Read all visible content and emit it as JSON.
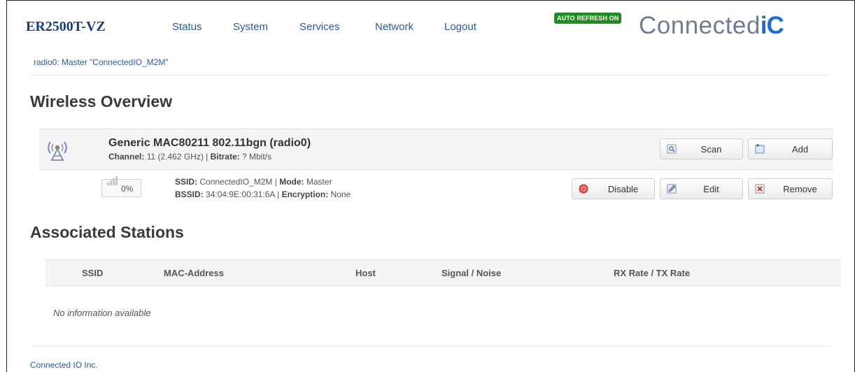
{
  "header": {
    "brand": "ER2500T-VZ",
    "nav": [
      {
        "label": "Status"
      },
      {
        "label": "System"
      },
      {
        "label": "Services"
      },
      {
        "label": "Network"
      },
      {
        "label": "Logout"
      }
    ],
    "auto_refresh": "AUTO REFRESH ON",
    "logo_text": "Connected",
    "logo_accent": "iC"
  },
  "breadcrumb": "radio0: Master \"ConnectedIO_M2M\"",
  "wireless": {
    "title": "Wireless Overview",
    "device": {
      "name": "Generic MAC80211 802.11bgn (radio0)",
      "channel_label": "Channel:",
      "channel_value": "11 (2.462 GHz)",
      "bitrate_label": "Bitrate:",
      "bitrate_value": "? Mbit/s",
      "icon": "wireless-radio-icon",
      "buttons": {
        "scan": "Scan",
        "add": "Add"
      }
    },
    "network": {
      "signal": "0%",
      "signal_fraction": 0.0,
      "ssid_label": "SSID:",
      "ssid_value": "ConnectedIO_M2M",
      "mode_label": "Mode:",
      "mode_value": "Master",
      "bssid_label": "BSSID:",
      "bssid_value": "34:04:9E:00:31:6A",
      "encryption_label": "Encryption:",
      "encryption_value": "None",
      "buttons": {
        "disable": "Disable",
        "edit": "Edit",
        "remove": "Remove"
      }
    }
  },
  "stations": {
    "title": "Associated Stations",
    "columns": [
      "SSID",
      "MAC-Address",
      "Host",
      "Signal / Noise",
      "RX Rate / TX Rate"
    ],
    "empty_text": "No information available"
  },
  "footer": "Connected IO Inc.",
  "colors": {
    "link": "#2c5aa0",
    "brand": "#1a3d7c",
    "auto_refresh_bg": "#1e8c1e",
    "logo_accent": "#1b6fd6"
  }
}
